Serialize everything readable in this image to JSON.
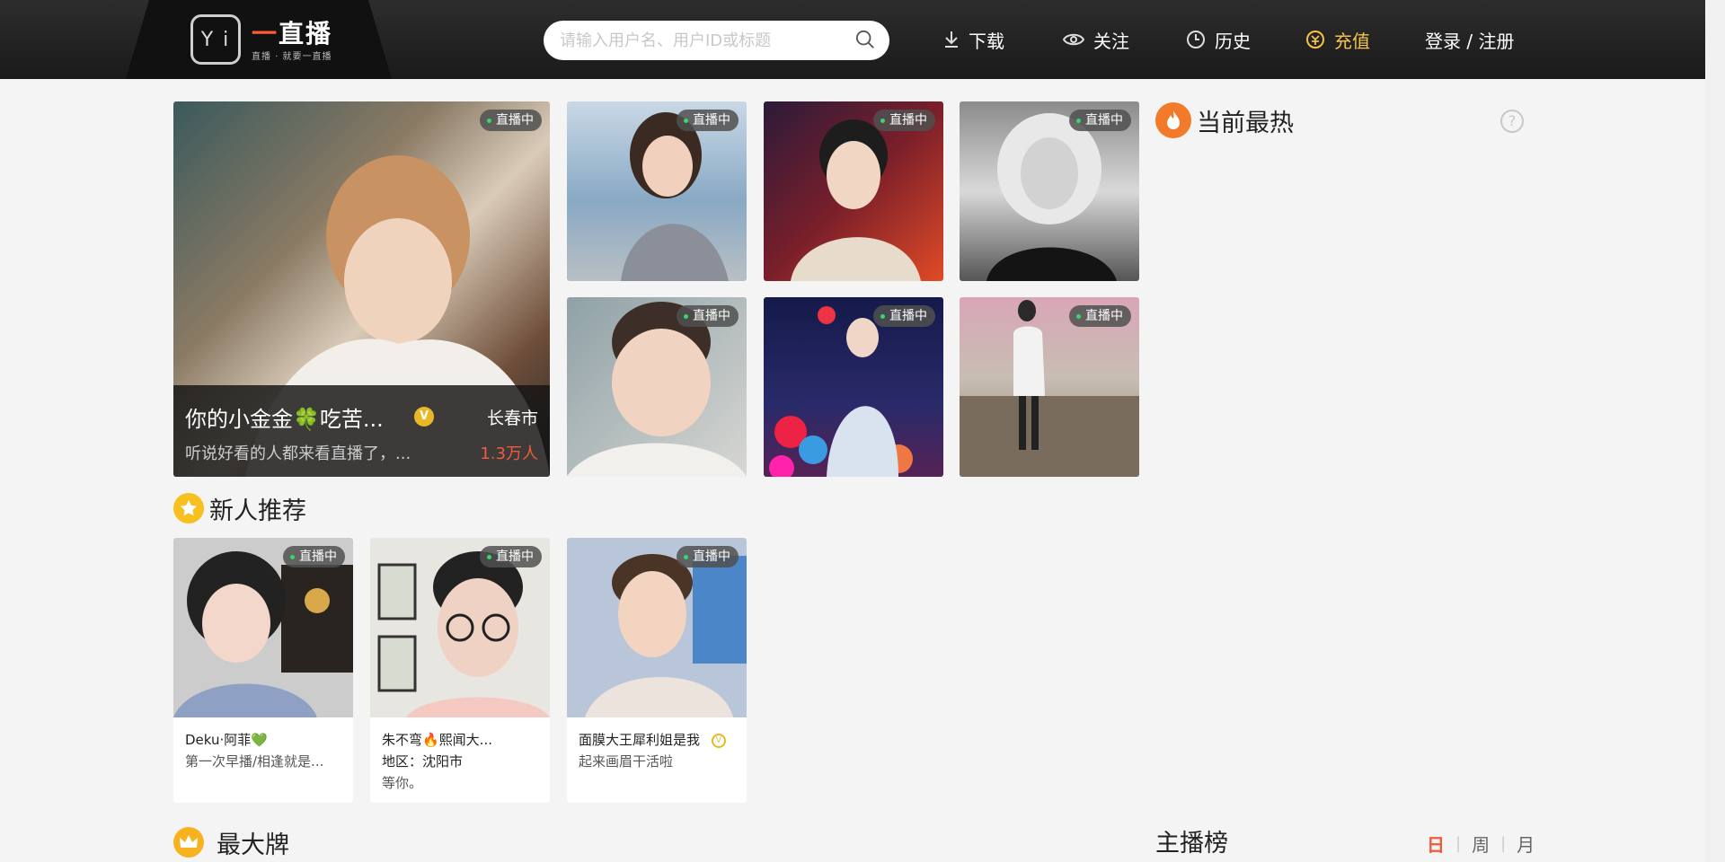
{
  "header": {
    "logo_glyph": "Y i",
    "logo_first": "一",
    "logo_rest": "直播",
    "logo_slogan": "直播 · 就要一直播",
    "search_placeholder": "请输入用户名、用户ID或标题",
    "nav": {
      "download": "下载",
      "follow": "关注",
      "history": "历史",
      "recharge": "充值",
      "login": "登录 / 注册"
    }
  },
  "live_badge": "直播中",
  "featured": {
    "title": "你的小金金🍀吃苦...",
    "verified": "V",
    "city": "长春市",
    "desc": "听说好看的人都来看直播了，...",
    "viewers": "1.3万人"
  },
  "hot_section": {
    "title": "当前最热",
    "help": "?"
  },
  "newbie_section": {
    "title": "新人推荐",
    "items": [
      {
        "name": "Deku·阿菲💚",
        "line2": "第一次早播/相逢就是...",
        "line3": ""
      },
      {
        "name": "朱不弯🔥熙闻大...",
        "line2": "地区：沈阳市",
        "line3": "等你。"
      },
      {
        "name": "面膜大王犀利姐是我",
        "line2": "起来画眉干活啦",
        "line3": ""
      }
    ]
  },
  "bigcard_section": {
    "title": "最大牌"
  },
  "rank_section": {
    "title": "主播榜",
    "tabs": {
      "day": "日",
      "week": "周",
      "month": "月"
    }
  },
  "colors": {
    "accent": "#f25a3a",
    "gold": "#f5c34c",
    "live_dot": "#35d86a"
  }
}
